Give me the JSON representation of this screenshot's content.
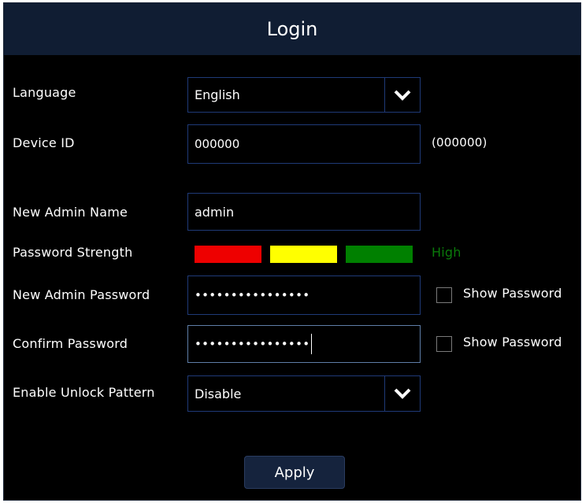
{
  "title": "Login",
  "language": {
    "label": "Language",
    "value": "English"
  },
  "device_id": {
    "label": "Device ID",
    "value": "000000",
    "hint": "(000000)"
  },
  "admin_name": {
    "label": "New Admin Name",
    "value": "admin"
  },
  "strength": {
    "label": "Password Strength",
    "level_text": "High",
    "colors": {
      "weak": "#ee0000",
      "medium": "#ffff00",
      "strong": "#008000",
      "level_text": "#0a7a0a"
    }
  },
  "admin_password": {
    "label": "New Admin Password",
    "masked": "••••••••••••••••",
    "show_label": "Show Password",
    "show_checked": false
  },
  "confirm_password": {
    "label": "Confirm Password",
    "masked": "••••••••••••••••",
    "show_label": "Show Password",
    "show_checked": false
  },
  "unlock_pattern": {
    "label": "Enable Unlock Pattern",
    "value": "Disable"
  },
  "apply_label": "Apply",
  "icons": {
    "dropdown": "chevron-down-icon",
    "checkbox": "checkbox-unchecked-icon"
  }
}
